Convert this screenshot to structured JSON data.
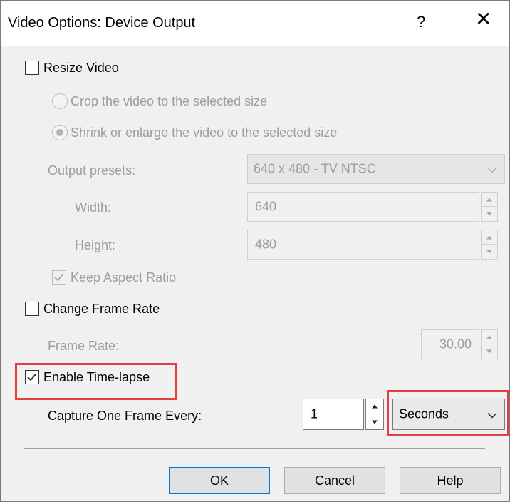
{
  "window": {
    "title": "Video Options: Device Output",
    "help_glyph": "?",
    "close_glyph": "✕"
  },
  "resize": {
    "label": "Resize Video",
    "checked": false,
    "crop_label": "Crop the video to the selected size",
    "shrink_label": "Shrink or enlarge the video to the selected size",
    "selected_mode": "shrink",
    "presets_label": "Output presets:",
    "presets_value": "640 x 480 - TV NTSC",
    "width_label": "Width:",
    "width_value": "640",
    "height_label": "Height:",
    "height_value": "480",
    "keep_aspect_label": "Keep Aspect Ratio",
    "keep_aspect_checked": true
  },
  "frame_rate": {
    "label": "Change Frame Rate",
    "checked": false,
    "rate_label": "Frame Rate:",
    "rate_value": "30.00"
  },
  "timelapse": {
    "label": "Enable Time-lapse",
    "checked": true,
    "capture_label": "Capture One Frame Every:",
    "interval_value": "1",
    "unit_value": "Seconds"
  },
  "buttons": {
    "ok": "OK",
    "cancel": "Cancel",
    "help": "Help"
  },
  "colors": {
    "highlight": "#e04040",
    "default_button_border": "#0078d7",
    "disabled_text": "#9d9d9d"
  }
}
